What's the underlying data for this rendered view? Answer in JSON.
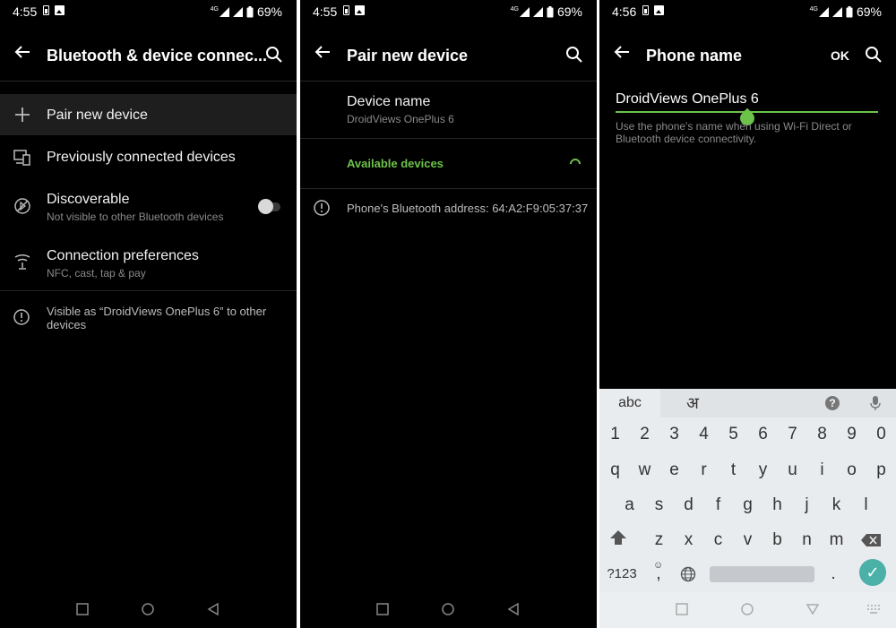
{
  "screens": [
    {
      "status": {
        "time": "4:55",
        "battery": "69%",
        "signal_label": "4G"
      },
      "title": "Bluetooth & device connec...",
      "items": [
        {
          "label": "Pair new device",
          "sub": ""
        },
        {
          "label": "Previously connected devices",
          "sub": ""
        },
        {
          "label": "Discoverable",
          "sub": "Not visible to other Bluetooth devices"
        },
        {
          "label": "Connection preferences",
          "sub": "NFC, cast, tap & pay"
        }
      ],
      "footer_info": "Visible as “DroidViews OnePlus 6” to other devices"
    },
    {
      "status": {
        "time": "4:55",
        "battery": "69%",
        "signal_label": "4G"
      },
      "title": "Pair new device",
      "device_name_label": "Device name",
      "device_name_value": "DroidViews OnePlus 6",
      "available_label": "Available devices",
      "bt_address": "Phone's Bluetooth address: 64:A2:F9:05:37:37"
    },
    {
      "status": {
        "time": "4:56",
        "battery": "69%",
        "signal_label": "4G"
      },
      "title": "Phone name",
      "ok_label": "OK",
      "input_value": "DroidViews OnePlus 6",
      "hint": "Use the phone's name when using Wi-Fi Direct or Bluetooth device connectivity.",
      "keyboard": {
        "tab_abc": "abc",
        "tab_hindi": "अ",
        "help": "?",
        "row_numbers": [
          "1",
          "2",
          "3",
          "4",
          "5",
          "6",
          "7",
          "8",
          "9",
          "0"
        ],
        "row1": [
          "q",
          "w",
          "e",
          "r",
          "t",
          "y",
          "u",
          "i",
          "o",
          "p"
        ],
        "row2": [
          "a",
          "s",
          "d",
          "f",
          "g",
          "h",
          "j",
          "k",
          "l"
        ],
        "row3": [
          "z",
          "x",
          "c",
          "v",
          "b",
          "n",
          "m"
        ],
        "symbols": "?123",
        "comma": ",",
        "period": "."
      }
    }
  ],
  "colors": {
    "accent_green": "#6cc24a",
    "enter_key": "#4ab0a8"
  }
}
